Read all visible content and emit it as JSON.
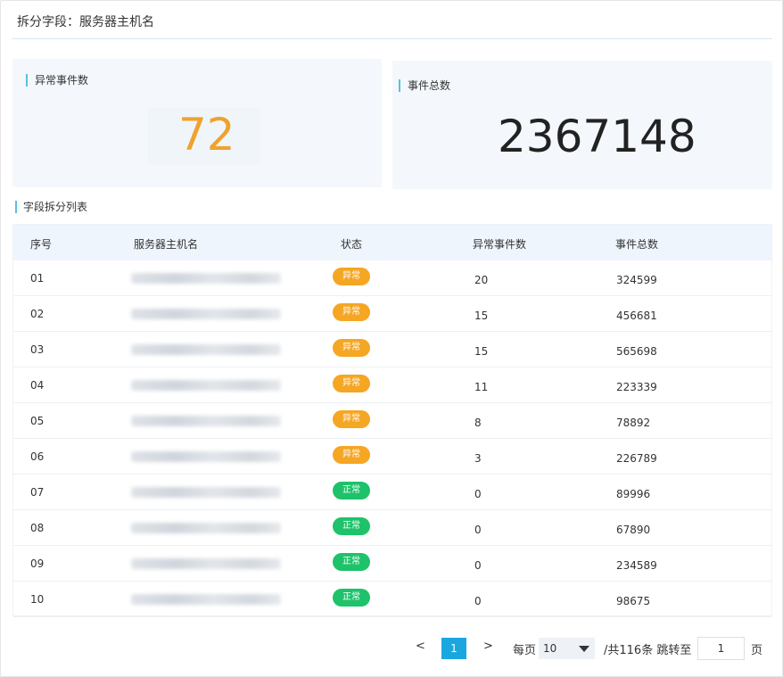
{
  "header": {
    "title": "拆分字段：服务器主机名"
  },
  "cards": {
    "abnormal": {
      "label": "异常事件数",
      "value": "72",
      "color": "#f0a22e"
    },
    "total": {
      "label": "事件总数",
      "value": "2367148"
    }
  },
  "section": {
    "label": "字段拆分列表"
  },
  "table": {
    "columns": [
      "序号",
      "服务器主机名",
      "状态",
      "异常事件数",
      "事件总数"
    ],
    "rows": [
      {
        "index": "01",
        "status": "异常",
        "abnormal": "20",
        "total": "324599"
      },
      {
        "index": "02",
        "status": "异常",
        "abnormal": "15",
        "total": "456681"
      },
      {
        "index": "03",
        "status": "异常",
        "abnormal": "15",
        "total": "565698"
      },
      {
        "index": "04",
        "status": "异常",
        "abnormal": "11",
        "total": "223339"
      },
      {
        "index": "05",
        "status": "异常",
        "abnormal": "8",
        "total": "78892"
      },
      {
        "index": "06",
        "status": "异常",
        "abnormal": "3",
        "total": "226789"
      },
      {
        "index": "07",
        "status": "正常",
        "abnormal": "0",
        "total": "89996"
      },
      {
        "index": "08",
        "status": "正常",
        "abnormal": "0",
        "total": "67890"
      },
      {
        "index": "09",
        "status": "正常",
        "abnormal": "0",
        "total": "234589"
      },
      {
        "index": "10",
        "status": "正常",
        "abnormal": "0",
        "total": "98675"
      }
    ],
    "status_colors": {
      "异常": "#f5a623",
      "正常": "#1ec26a"
    }
  },
  "pagination": {
    "prev": "<",
    "current_page": "1",
    "next": ">",
    "per_page_label": "每页",
    "per_page_value": "10",
    "total_text": "/共116条 跳转至",
    "jump_value": "1",
    "page_unit": "页",
    "active_color": "#1aa7e0"
  }
}
